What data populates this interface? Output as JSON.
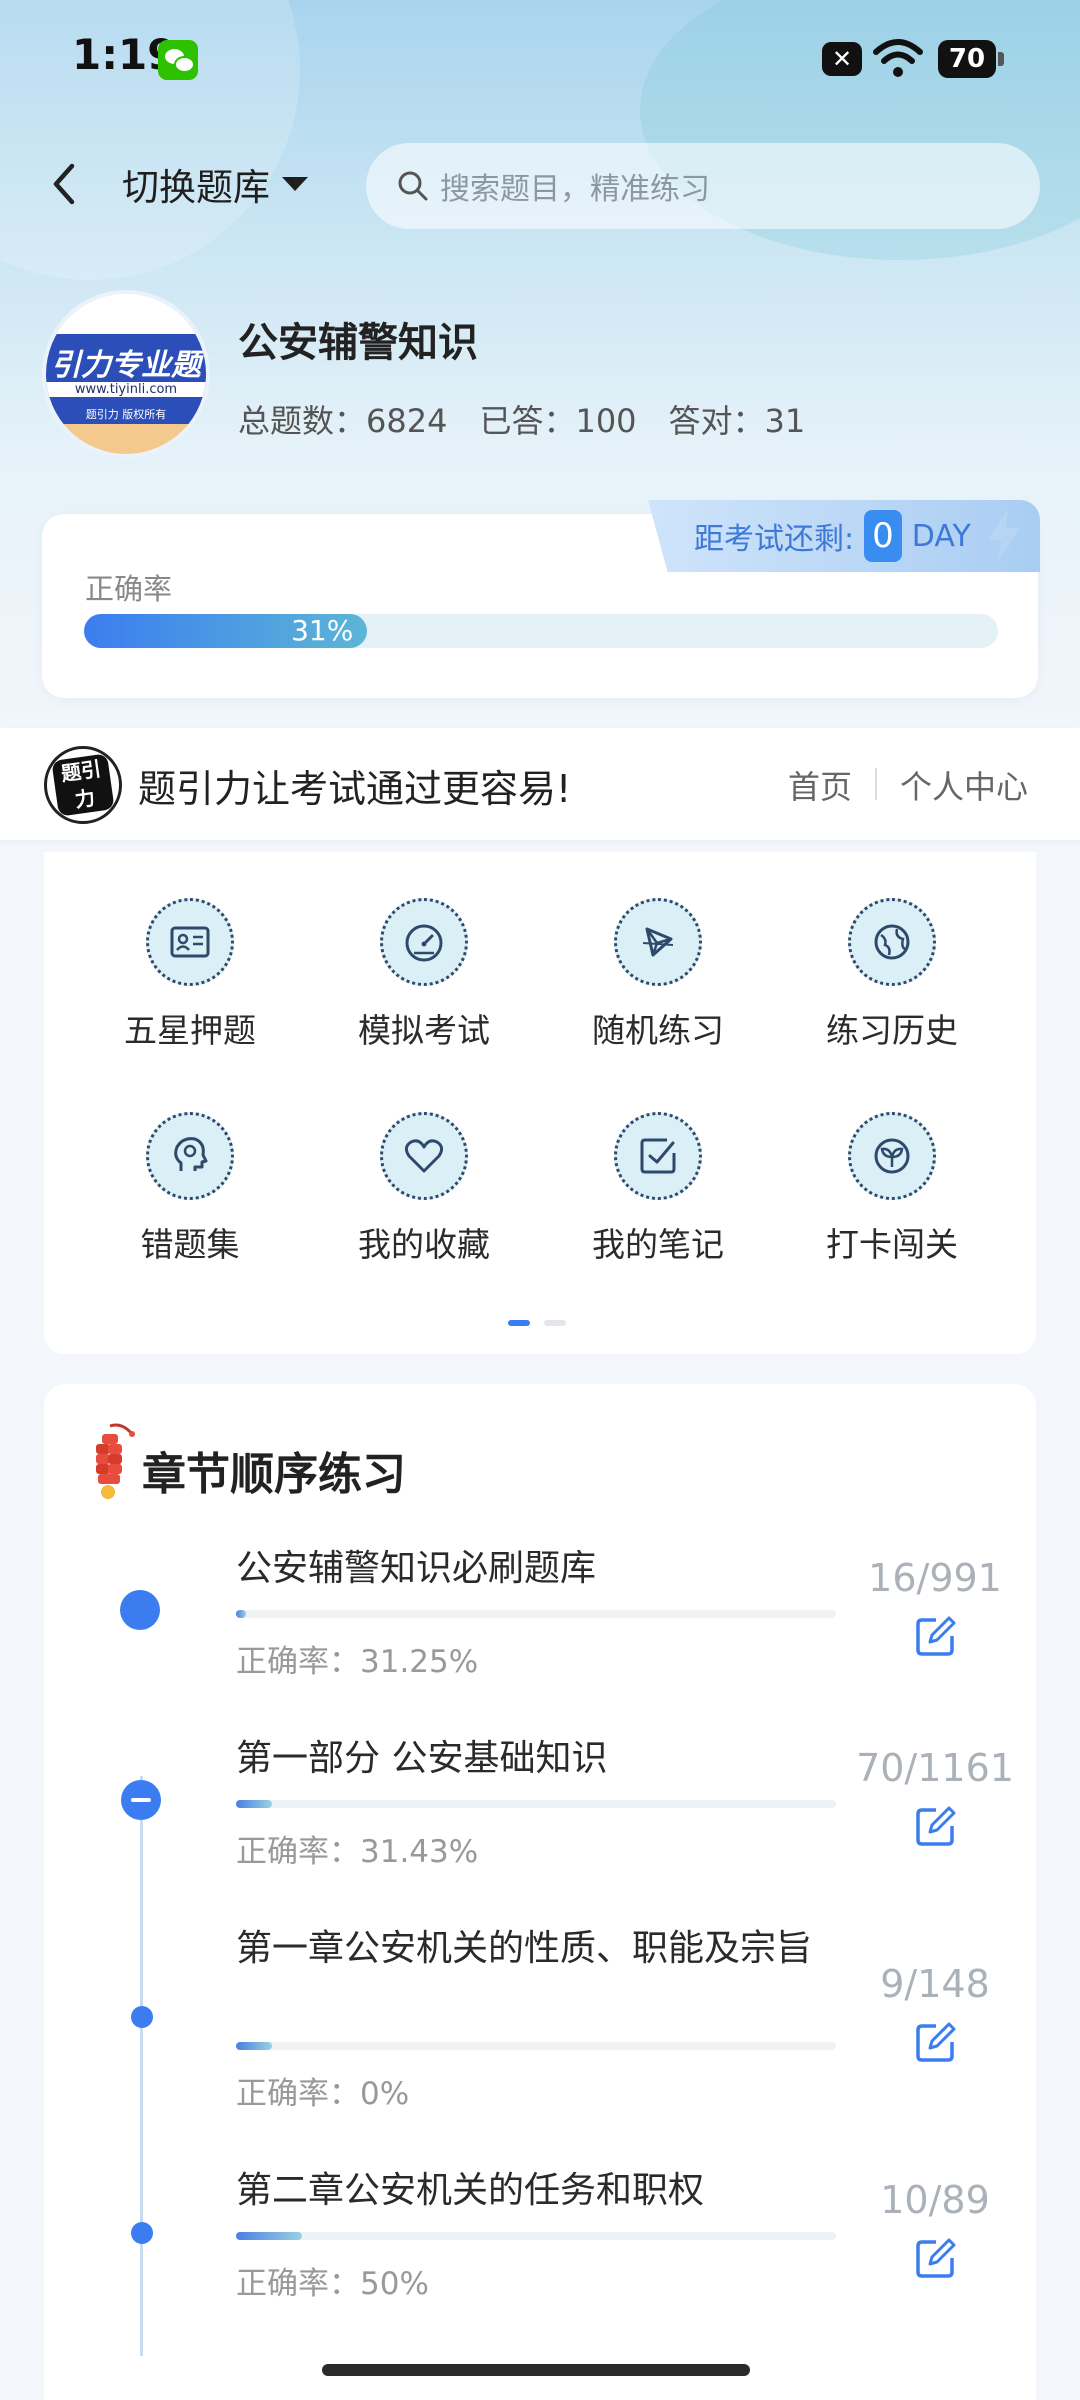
{
  "status": {
    "time": "1:19",
    "battery": "70",
    "x_badge": "✕"
  },
  "header": {
    "switch_label": "切换题库",
    "search_placeholder": "搜索题目，精准练习"
  },
  "bank": {
    "logo_line1": "引力专业题",
    "logo_line2": "www.tiyinli.com",
    "logo_line3": "题引力 版权所有",
    "name": "公安辅警知识",
    "total_label": "总题数：6824",
    "answered_label": "已答：100",
    "correct_label": "答对：31"
  },
  "accuracy": {
    "label": "正确率",
    "value_text": "31%",
    "value": 31,
    "countdown_prefix": "距考试还剩:",
    "countdown_days": "0",
    "countdown_unit": "DAY"
  },
  "nav": {
    "brand_mark": "题引力",
    "slogan": "题引力让考试通过更容易!",
    "home": "首页",
    "personal": "个人中心"
  },
  "features": [
    {
      "label": "五星押题",
      "icon": "id-card-icon"
    },
    {
      "label": "模拟考试",
      "icon": "gauge-icon"
    },
    {
      "label": "随机练习",
      "icon": "shuffle-icon"
    },
    {
      "label": "练习历史",
      "icon": "globe-icon"
    },
    {
      "label": "错题集",
      "icon": "head-icon"
    },
    {
      "label": "我的收藏",
      "icon": "heart-icon"
    },
    {
      "label": "我的笔记",
      "icon": "note-check-icon"
    },
    {
      "label": "打卡闯关",
      "icon": "sprout-icon"
    }
  ],
  "pager": {
    "pages": 2,
    "active": 0
  },
  "chapters": {
    "title": "章节顺序练习",
    "items": [
      {
        "name": "公安辅警知识必刷题库",
        "accuracy": "正确率：31.25%",
        "count": "16/991",
        "progress": 0.016
      },
      {
        "name": "第一部分 公安基础知识",
        "accuracy": "正确率：31.43%",
        "count": "70/1161",
        "progress": 0.06
      },
      {
        "name": "第一章公安机关的性质、职能及宗旨",
        "accuracy": "正确率：0%",
        "count": "9/148",
        "progress": 0.06
      },
      {
        "name": "第二章公安机关的任务和职权",
        "accuracy": "正确率：50%",
        "count": "10/89",
        "progress": 0.11
      }
    ]
  },
  "colors": {
    "accent": "#3b7df0",
    "teal": "#5cb6d6"
  }
}
